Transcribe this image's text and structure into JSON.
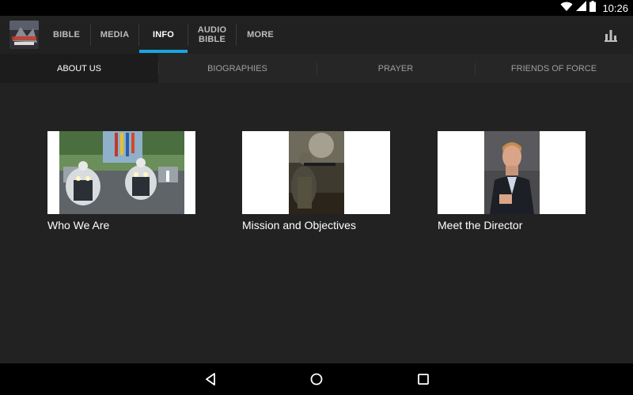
{
  "status_bar": {
    "time": "10:26",
    "icons": [
      "wifi-icon",
      "cellular-signal-icon",
      "battery-icon"
    ]
  },
  "app_bar": {
    "logo": "app-logo",
    "tabs": [
      {
        "label": "BIBLE",
        "active": false
      },
      {
        "label": "MEDIA",
        "active": false
      },
      {
        "label": "INFO",
        "active": true
      },
      {
        "label": "AUDIO\nBIBLE",
        "active": false
      },
      {
        "label": "MORE",
        "active": false
      }
    ],
    "indicator_color": "#1ba5e0",
    "action_icon": "bar-chart-icon"
  },
  "sub_tabs": [
    {
      "label": "ABOUT US",
      "active": true
    },
    {
      "label": "BIOGRAPHIES",
      "active": false
    },
    {
      "label": "PRAYER",
      "active": false
    },
    {
      "label": "FRIENDS OF FORCE",
      "active": false
    }
  ],
  "cards": [
    {
      "caption": "Who We Are",
      "image": "motorcycle-parade-photo"
    },
    {
      "caption": "Mission and Objectives",
      "image": "soldier-with-rifle-photo"
    },
    {
      "caption": "Meet the Director",
      "image": "director-portrait-photo"
    }
  ],
  "nav_bar": {
    "buttons": [
      "back-icon",
      "home-icon",
      "recents-icon"
    ]
  },
  "colors": {
    "app_bar_bg": "#212121",
    "content_bg": "#222222",
    "accent": "#1ba5e0"
  }
}
